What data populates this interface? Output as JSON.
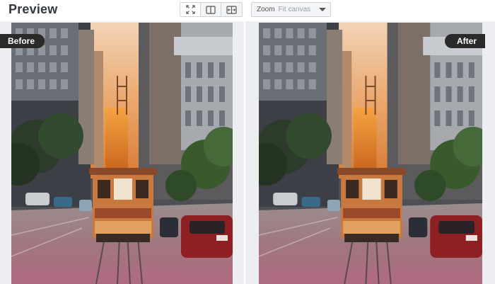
{
  "header": {
    "title": "Preview"
  },
  "view_modes": [
    {
      "icon": "fit-screen-icon",
      "active": true
    },
    {
      "icon": "split-view-icon",
      "active": false
    },
    {
      "icon": "compare-slider-icon",
      "active": false
    }
  ],
  "zoom": {
    "label": "Zoom",
    "value": "Fit canvas"
  },
  "panels": {
    "before": {
      "badge": "Before"
    },
    "after": {
      "badge": "After"
    }
  },
  "colors": {
    "badge_bg": "#2a2a2a",
    "canvas_bg": "#eceef1",
    "title": "#333740"
  }
}
